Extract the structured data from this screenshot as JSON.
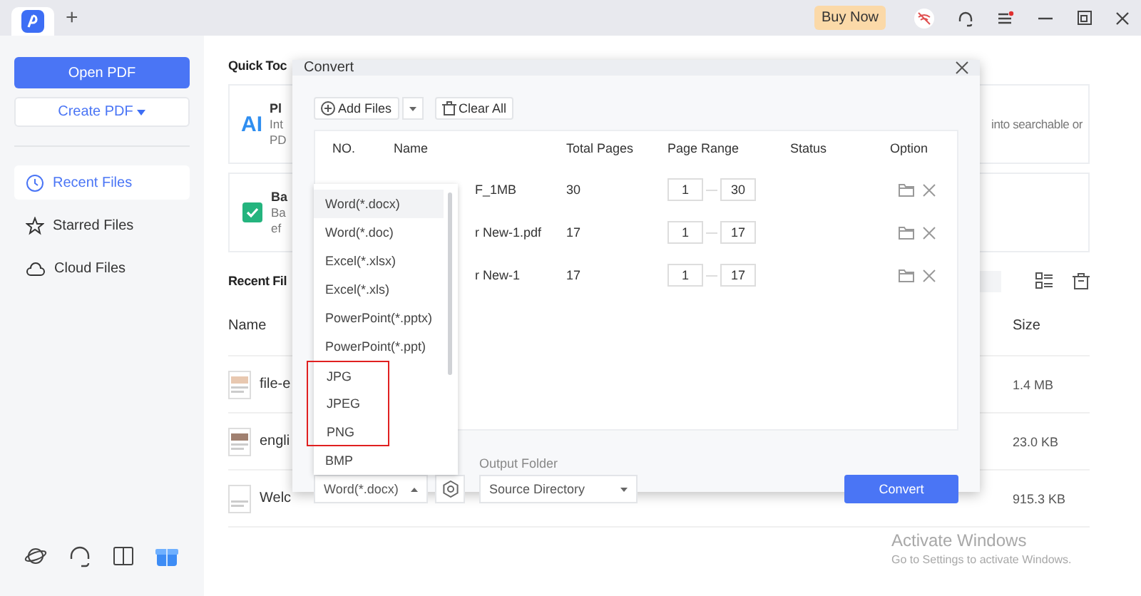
{
  "titlebar": {
    "new_tab": "+",
    "buy_now": "Buy Now"
  },
  "sidebar": {
    "open_pdf": "Open PDF",
    "create_pdf": "Create PDF",
    "items": [
      {
        "label": "Recent Files",
        "selected": true
      },
      {
        "label": "Starred Files",
        "selected": false
      },
      {
        "label": "Cloud Files",
        "selected": false
      }
    ]
  },
  "quick_tools": {
    "title": "Quick Toc",
    "cards": [
      {
        "logo": "AI",
        "title": "Pl",
        "lines": [
          "Int",
          "PD"
        ],
        "right_text": "into searchable or"
      },
      {
        "title": "Ba",
        "lines": [
          "Ba",
          "ef"
        ]
      }
    ]
  },
  "recent_files": {
    "title": "Recent Fil",
    "columns": [
      "Name",
      "Size"
    ],
    "rows": [
      {
        "name": "file-e",
        "size": "1.4 MB"
      },
      {
        "name": "engli",
        "size": "23.0 KB"
      },
      {
        "name": "Welc",
        "size": "915.3 KB"
      }
    ]
  },
  "dialog": {
    "title": "Convert",
    "add_files": "Add Files",
    "clear_all": "Clear All",
    "columns": [
      "NO.",
      "Name",
      "Total Pages",
      "Page Range",
      "Status",
      "Option"
    ],
    "rows": [
      {
        "name": "F_1MB",
        "total_pages": "30",
        "range_from": "1",
        "range_to": "30"
      },
      {
        "name": "r New-1.pdf",
        "total_pages": "17",
        "range_from": "1",
        "range_to": "17"
      },
      {
        "name": "r New-1",
        "total_pages": "17",
        "range_from": "1",
        "range_to": "17"
      }
    ],
    "format_menu": [
      {
        "label": "Word(*.docx)",
        "selected": true,
        "highlighted": false
      },
      {
        "label": "Word(*.doc)",
        "selected": false,
        "highlighted": false
      },
      {
        "label": "Excel(*.xlsx)",
        "selected": false,
        "highlighted": false
      },
      {
        "label": "Excel(*.xls)",
        "selected": false,
        "highlighted": false
      },
      {
        "label": "PowerPoint(*.pptx)",
        "selected": false,
        "highlighted": false
      },
      {
        "label": "PowerPoint(*.ppt)",
        "selected": false,
        "highlighted": false
      },
      {
        "label": "JPG",
        "selected": false,
        "highlighted": true
      },
      {
        "label": "JPEG",
        "selected": false,
        "highlighted": true
      },
      {
        "label": "PNG",
        "selected": false,
        "highlighted": true
      },
      {
        "label": "BMP",
        "selected": false,
        "highlighted": false
      }
    ],
    "output_format": "Word(*.docx)",
    "output_folder_label": "Output Folder",
    "output_folder": "Source Directory",
    "convert": "Convert"
  },
  "watermark": {
    "title": "Activate Windows",
    "subtitle": "Go to Settings to activate Windows."
  }
}
